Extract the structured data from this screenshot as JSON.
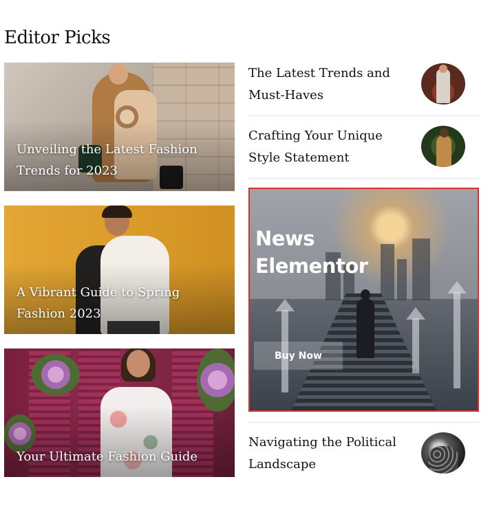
{
  "section": {
    "title": "Editor Picks"
  },
  "featured": [
    {
      "title": "Unveiling the Latest Fashion Trends for 2023"
    },
    {
      "title": "A Vibrant Guide to Spring Fashion 2023"
    },
    {
      "title": "Your Ultimate Fashion Guide"
    }
  ],
  "list": [
    {
      "title": "The Latest Trends and Must-Haves",
      "thumb_icon": "man-portrait-thumbnail"
    },
    {
      "title": "Crafting Your Unique Style Statement",
      "thumb_icon": "woman-portrait-thumbnail"
    },
    {
      "title": "Navigating the Political Landscape",
      "thumb_icon": "crowd-thumbnail"
    }
  ],
  "ad": {
    "title": "News Elementor",
    "button_label": "Buy Now",
    "border_color": "#d63130"
  }
}
